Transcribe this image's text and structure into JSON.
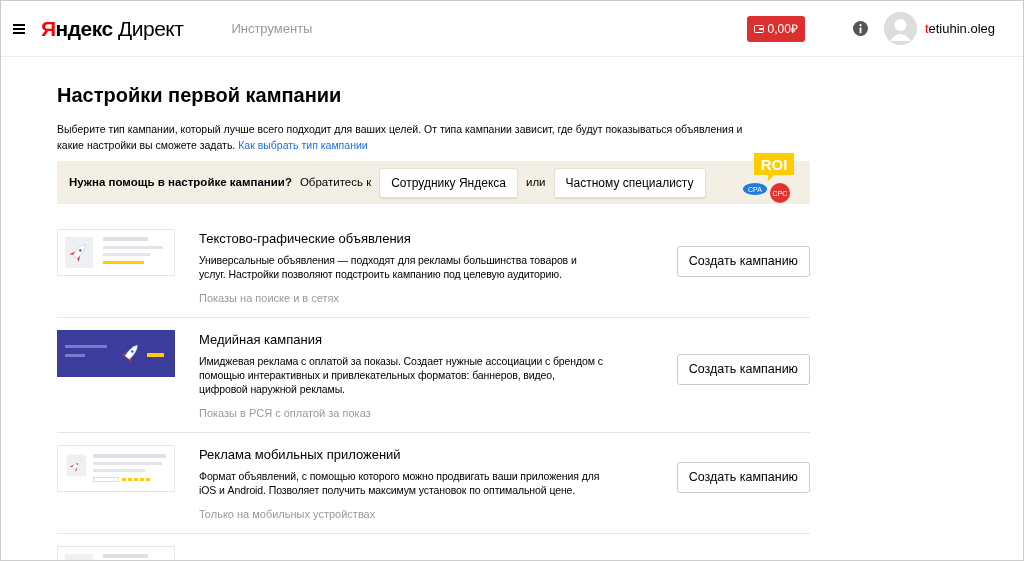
{
  "header": {
    "logo": {
      "brand": "Яндекс",
      "product": "Директ"
    },
    "nav": [
      "Инструменты"
    ],
    "balance": "0,00₽",
    "user": "tetiuhin.oleg"
  },
  "page": {
    "title": "Настройки первой кампании",
    "intro": "Выберите тип кампании, который лучше всего подходит для ваших целей. От типа кампании зависит, где будут показываться объявления и какие настройки вы сможете задать.",
    "intro_link": "Как выбрать тип кампании"
  },
  "help": {
    "question": "Нужна помощь в настройке кампании?",
    "contact": "Обратитесь к",
    "option_1": "Сотруднику Яндекса",
    "or": "или",
    "option_2": "Частному специалисту",
    "badges": [
      "ROI",
      "CPA",
      "CPC"
    ]
  },
  "campaigns": [
    {
      "kind": "text",
      "title": "Текстово-графические объявления",
      "description": "Универсальные объявления — подходят для рекламы большинства товаров и услуг. Настройки позволяют подстроить кампанию под целевую аудиторию.",
      "placement": "Показы на поиске и в сетях",
      "button": "Создать кампанию"
    },
    {
      "kind": "media",
      "title": "Медийная кампания",
      "description": "Имиджевая реклама с оплатой за показы. Создает нужные ассоциации с брендом с помощью интерактивных и привлекательных форматов: баннеров, видео, цифровой наружной рекламы.",
      "placement": "Показы в РСЯ с оплатой за показ",
      "button": "Создать кампанию"
    },
    {
      "kind": "mobile",
      "title": "Реклама мобильных приложений",
      "description": "Формат объявлений, с помощью которого можно продвигать ваши приложения для iOS и Android. Позволяет получить максимум установок по оптимальной цене.",
      "placement": "Только на мобильных устройствах",
      "button": "Создать кампанию"
    },
    {
      "kind": "text"
    }
  ]
}
